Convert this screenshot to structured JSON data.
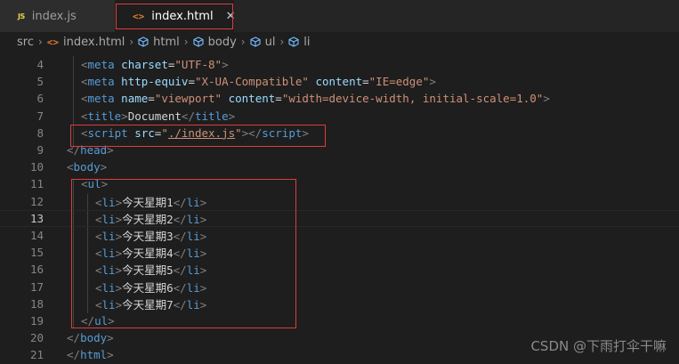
{
  "tabs": [
    {
      "icon": "JS",
      "label": "index.js",
      "active": false
    },
    {
      "icon": "<>",
      "label": "index.html",
      "active": true,
      "close": "✕"
    }
  ],
  "breadcrumb": [
    {
      "label": "src",
      "icon": ""
    },
    {
      "label": "index.html",
      "icon": "html-file-icon"
    },
    {
      "label": "html",
      "icon": "element-cube-icon"
    },
    {
      "label": "body",
      "icon": "element-cube-icon"
    },
    {
      "label": "ul",
      "icon": "element-cube-icon"
    },
    {
      "label": "li",
      "icon": "element-cube-icon"
    }
  ],
  "editor": {
    "current_line": 13,
    "lines": [
      {
        "n": "4",
        "html": "<span class=\"tg\">&lt;</span><span class=\"tn\">meta</span> <span class=\"an\">charset</span><span class=\"tx\">=</span><span class=\"av\">\"UTF-8\"</span><span class=\"tg\">&gt;</span>",
        "indent": 1
      },
      {
        "n": "5",
        "html": "<span class=\"tg\">&lt;</span><span class=\"tn\">meta</span> <span class=\"an\">http-equiv</span><span class=\"tx\">=</span><span class=\"av\">\"X-UA-Compatible\"</span> <span class=\"an\">content</span><span class=\"tx\">=</span><span class=\"av\">\"IE=edge\"</span><span class=\"tg\">&gt;</span>",
        "indent": 1
      },
      {
        "n": "6",
        "html": "<span class=\"tg\">&lt;</span><span class=\"tn\">meta</span> <span class=\"an\">name</span><span class=\"tx\">=</span><span class=\"av\">\"viewport\"</span> <span class=\"an\">content</span><span class=\"tx\">=</span><span class=\"av\">\"width=device-width, initial-scale=1.0\"</span><span class=\"tg\">&gt;</span>",
        "indent": 1
      },
      {
        "n": "7",
        "html": "<span class=\"tg\">&lt;</span><span class=\"tn\">title</span><span class=\"tg\">&gt;</span><span class=\"tx\">Document</span><span class=\"tg\">&lt;/</span><span class=\"tn\">title</span><span class=\"tg\">&gt;</span>",
        "indent": 1
      },
      {
        "n": "8",
        "html": "<span class=\"tg\">&lt;</span><span class=\"tn\">script</span> <span class=\"an\">src</span><span class=\"tx\">=</span><span class=\"av\">\"</span><span class=\"av-u\">./index.js</span><span class=\"av\">\"</span><span class=\"tg\">&gt;&lt;/</span><span class=\"tn\">script</span><span class=\"tg\">&gt;</span>",
        "indent": 1
      },
      {
        "n": "9",
        "html": "<span class=\"tg\">&lt;/</span><span class=\"tn\">head</span><span class=\"tg\">&gt;</span>",
        "indent": 0
      },
      {
        "n": "10",
        "html": "<span class=\"tg\">&lt;</span><span class=\"tn\">body</span><span class=\"tg\">&gt;</span>",
        "indent": 0
      },
      {
        "n": "11",
        "html": "<span class=\"tg\">&lt;</span><span class=\"tn\">ul</span><span class=\"tg\">&gt;</span>",
        "indent": 1
      },
      {
        "n": "12",
        "html": "<span class=\"tg\">&lt;</span><span class=\"tn\">li</span><span class=\"tg\">&gt;</span><span class=\"tx\">今天星期1</span><span class=\"tg\">&lt;/</span><span class=\"tn\">li</span><span class=\"tg\">&gt;</span>",
        "indent": 2
      },
      {
        "n": "13",
        "html": "<span class=\"tg\">&lt;</span><span class=\"tn\">li</span><span class=\"tg\">&gt;</span><span class=\"tx\">今天星期2</span><span class=\"tg\">&lt;/</span><span class=\"tn\">li</span><span class=\"tg\">&gt;</span>",
        "indent": 2
      },
      {
        "n": "14",
        "html": "<span class=\"tg\">&lt;</span><span class=\"tn\">li</span><span class=\"tg\">&gt;</span><span class=\"tx\">今天星期3</span><span class=\"tg\">&lt;/</span><span class=\"tn\">li</span><span class=\"tg\">&gt;</span>",
        "indent": 2
      },
      {
        "n": "15",
        "html": "<span class=\"tg\">&lt;</span><span class=\"tn\">li</span><span class=\"tg\">&gt;</span><span class=\"tx\">今天星期4</span><span class=\"tg\">&lt;/</span><span class=\"tn\">li</span><span class=\"tg\">&gt;</span>",
        "indent": 2
      },
      {
        "n": "16",
        "html": "<span class=\"tg\">&lt;</span><span class=\"tn\">li</span><span class=\"tg\">&gt;</span><span class=\"tx\">今天星期5</span><span class=\"tg\">&lt;/</span><span class=\"tn\">li</span><span class=\"tg\">&gt;</span>",
        "indent": 2
      },
      {
        "n": "17",
        "html": "<span class=\"tg\">&lt;</span><span class=\"tn\">li</span><span class=\"tg\">&gt;</span><span class=\"tx\">今天星期6</span><span class=\"tg\">&lt;/</span><span class=\"tn\">li</span><span class=\"tg\">&gt;</span>",
        "indent": 2
      },
      {
        "n": "18",
        "html": "<span class=\"tg\">&lt;</span><span class=\"tn\">li</span><span class=\"tg\">&gt;</span><span class=\"tx\">今天星期7</span><span class=\"tg\">&lt;/</span><span class=\"tn\">li</span><span class=\"tg\">&gt;</span>",
        "indent": 2
      },
      {
        "n": "19",
        "html": "<span class=\"tg\">&lt;/</span><span class=\"tn\">ul</span><span class=\"tg\">&gt;</span>",
        "indent": 1
      },
      {
        "n": "20",
        "html": "<span class=\"tg\">&lt;/</span><span class=\"tn\">body</span><span class=\"tg\">&gt;</span>",
        "indent": 0
      },
      {
        "n": "21",
        "html": "<span class=\"tg\">&lt;/</span><span class=\"tn\">html</span><span class=\"tg\">&gt;</span>",
        "indent": 0
      }
    ]
  },
  "watermark": "CSDN @下雨打伞干嘛",
  "colors": {
    "highlight_box": "#e03b3b",
    "tag": "#569cd6",
    "attr": "#9cdcfe",
    "string": "#ce9178"
  }
}
